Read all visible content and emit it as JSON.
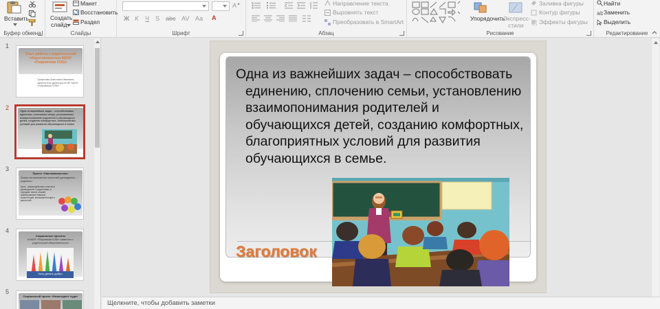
{
  "ribbon": {
    "clipboard": {
      "paste_label": "Вставить",
      "group_label": "Буфер обмена"
    },
    "slides": {
      "new_slide_label_1": "Создать",
      "new_slide_label_2": "слайд",
      "layout_label": "Макет",
      "reset_label": "Восстановить",
      "section_label": "Раздел",
      "group_label": "Слайды"
    },
    "font": {
      "group_label": "Шрифт",
      "bold": "Ж",
      "italic": "К",
      "underline": "Ч",
      "strike": "S",
      "case": "Аа"
    },
    "paragraph": {
      "text_direction_label": "Направление текста",
      "align_text_label": "Выровнять текст",
      "smartart_label": "Преобразовать в SmartArt",
      "group_label": "Абзац"
    },
    "drawing": {
      "arrange_label": "Упорядочить",
      "quick_styles_label_1": "Экспресс-",
      "quick_styles_label_2": "стили",
      "fill_label": "Заливка фигуры",
      "outline_label": "Контур фигуры",
      "effects_label": "Эффекты фигуры",
      "group_label": "Рисование"
    },
    "editing": {
      "find_label": "Найти",
      "replace_label": "Заменить",
      "select_label": "Выделить",
      "group_label": "Редактирование"
    }
  },
  "thumbnails": [
    {
      "number": "1",
      "title": "Опыт работы с родительской общественностью МАОУ «Покровская СОШ»",
      "subtitle": "Трифонова Анастасия Ивановна, заместитель директора по ВР МАОУ «Покровская СОШ»"
    },
    {
      "number": "2",
      "text": "Одна из важнейших задач – способствовать единению, сплочению семьи, установлению взаимопонимания родителей и обучающихся детей, созданию комфортных, благоприятных условий для развития обучающихся в семье."
    },
    {
      "number": "3",
      "title": "Проект «Наставничество»",
      "subtitle": "Форма наставничества «классный руководитель – родитель»",
      "text": "Цель - взаимодействие классного руководителя с родителями, в передаче опыта, знаний, формирование навыков, компетенций, метакомпетенций и ценностей."
    },
    {
      "number": "4",
      "title": "Социальные проекты",
      "subtitle": "в МАОУ «Покровская СОШ» совместно с родительской общественностью",
      "caption": "Хочу делать добро"
    },
    {
      "number": "5",
      "title": "Социальный проект «Новогоднее чудо»"
    }
  ],
  "slide": {
    "body_text": "Одна из важнейших задач – способствовать единению, сплочению семьи, установлению взаимопонимания родителей и обучающихся детей, созданию комфортных, благоприятных условий для развития обучающихся в семье.",
    "title_placeholder": "Заголовок"
  },
  "notes": {
    "placeholder": "Щелкните, чтобы добавить заметки"
  },
  "colors": {
    "accent": "#b83b2f",
    "title_orange": "#e07a3a"
  }
}
